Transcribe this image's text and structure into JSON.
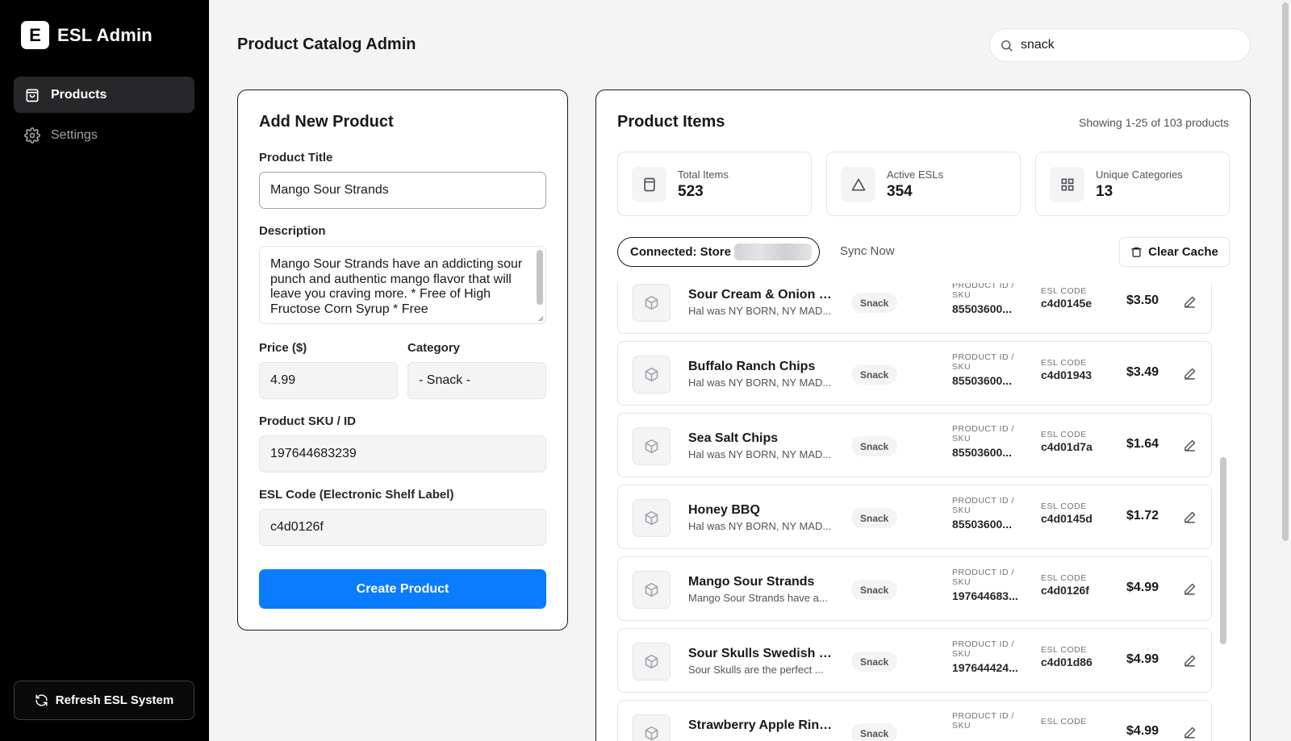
{
  "app": {
    "logo_letter": "E",
    "name": "ESL Admin"
  },
  "sidebar": {
    "items": [
      {
        "label": "Products",
        "icon": "bag-icon",
        "active": true
      },
      {
        "label": "Settings",
        "icon": "gear-icon",
        "active": false
      }
    ],
    "refresh_label": "Refresh ESL System"
  },
  "header": {
    "title": "Product Catalog Admin"
  },
  "search": {
    "value": "snack"
  },
  "form": {
    "title": "Add New Product",
    "product_title_label": "Product Title",
    "product_title_value": "Mango Sour Strands",
    "description_label": "Description",
    "description_value": "Mango Sour Strands have an addicting sour punch and authentic mango flavor that will leave you craving more. * Free of High Fructose Corn Syrup * Free",
    "price_label": "Price ($)",
    "price_value": "4.99",
    "category_label": "Category",
    "category_value": "- Snack -",
    "sku_label": "Product SKU / ID",
    "sku_value": "197644683239",
    "esl_label": "ESL Code (Electronic Shelf Label)",
    "esl_value": "c4d0126f",
    "submit_label": "Create Product"
  },
  "items_panel": {
    "title": "Product Items",
    "showing": "Showing 1-25 of 103 products",
    "stats": [
      {
        "label": "Total Items",
        "value": "523",
        "icon": "box-icon"
      },
      {
        "label": "Active ESLs",
        "value": "354",
        "icon": "triangle-icon"
      },
      {
        "label": "Unique Categories",
        "value": "13",
        "icon": "grid-icon"
      }
    ],
    "connection_label": "Connected: Store",
    "sync_label": "Sync Now",
    "clear_cache_label": "Clear Cache",
    "pid_label": "PRODUCT ID / SKU",
    "esl_label": "ESL CODE",
    "products": [
      {
        "name": "Sour Cream & Onion C...",
        "desc": "Hal was NY BORN, NY MAD...",
        "category": "Snack",
        "sku": "85503600...",
        "esl": "c4d0145e",
        "price": "$3.50"
      },
      {
        "name": "Buffalo Ranch Chips",
        "desc": "Hal was NY BORN, NY MAD...",
        "category": "Snack",
        "sku": "85503600...",
        "esl": "c4d01943",
        "price": "$3.49"
      },
      {
        "name": "Sea Salt Chips",
        "desc": "Hal was NY BORN, NY MAD...",
        "category": "Snack",
        "sku": "85503600...",
        "esl": "c4d01d7a",
        "price": "$1.64"
      },
      {
        "name": "Honey BBQ",
        "desc": "Hal was NY BORN, NY MAD...",
        "category": "Snack",
        "sku": "85503600...",
        "esl": "c4d0145d",
        "price": "$1.72"
      },
      {
        "name": "Mango Sour Strands",
        "desc": "Mango Sour Strands have a...",
        "category": "Snack",
        "sku": "197644683...",
        "esl": "c4d0126f",
        "price": "$4.99"
      },
      {
        "name": "Sour Skulls Swedish C...",
        "desc": "Sour Skulls are the perfect ...",
        "category": "Snack",
        "sku": "197644424...",
        "esl": "c4d01d86",
        "price": "$4.99"
      },
      {
        "name": "Strawberry Apple Rings",
        "desc": "",
        "category": "Snack",
        "sku": "",
        "esl": "",
        "price": "$4.99"
      }
    ]
  }
}
